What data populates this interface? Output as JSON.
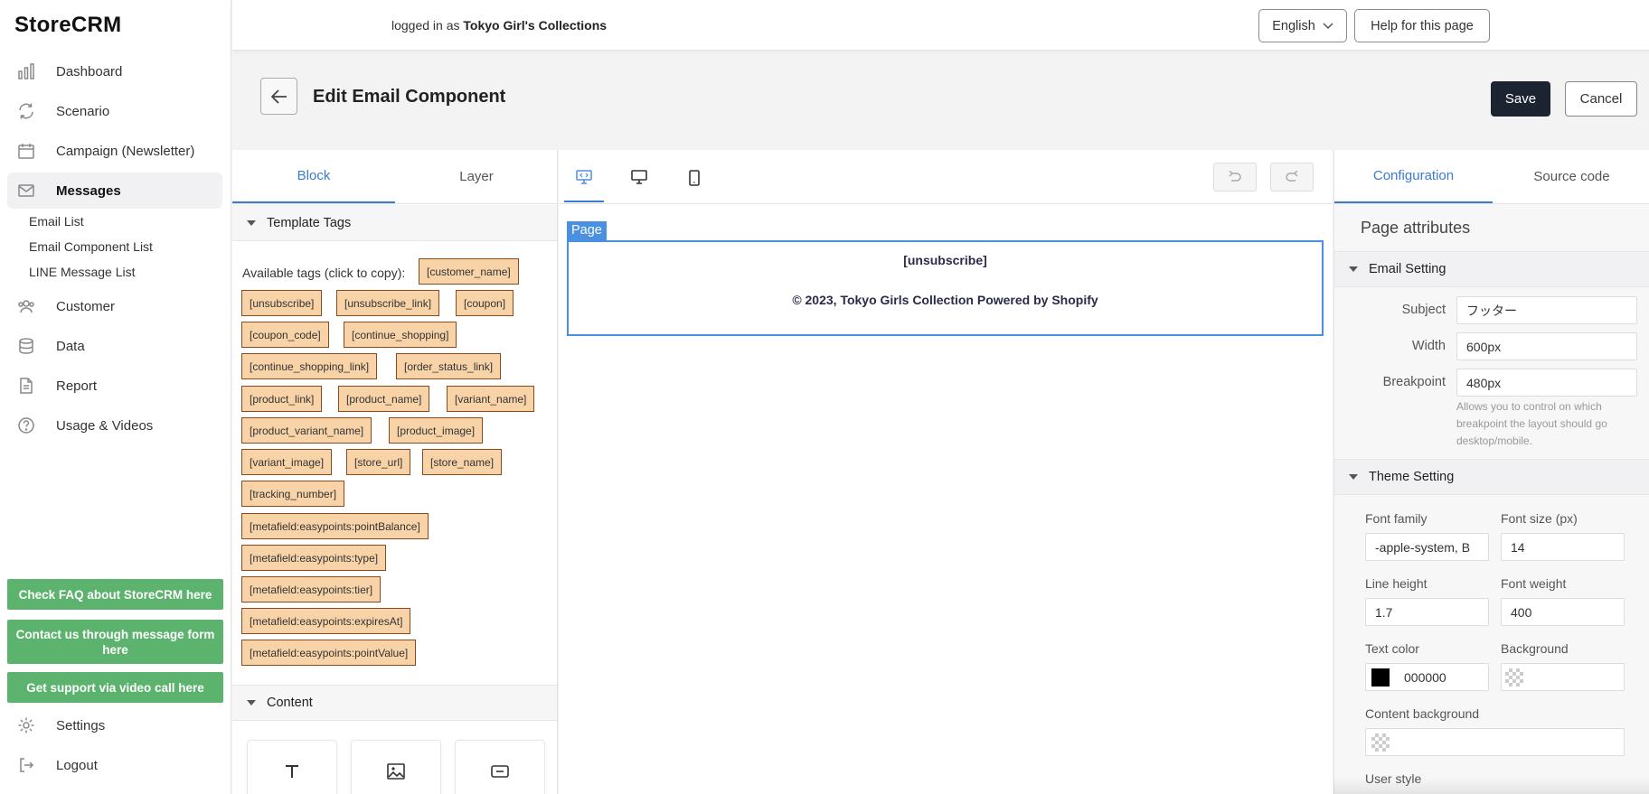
{
  "sidebar": {
    "logo": "StoreCRM",
    "nav": [
      {
        "label": "Dashboard",
        "icon": "chart-bars-icon"
      },
      {
        "label": "Scenario",
        "icon": "refresh-icon"
      },
      {
        "label": "Campaign (Newsletter)",
        "icon": "calendar-icon"
      },
      {
        "label": "Messages",
        "icon": "envelope-icon",
        "active": true
      },
      {
        "label": "Customer",
        "icon": "users-icon"
      },
      {
        "label": "Data",
        "icon": "database-icon"
      },
      {
        "label": "Report",
        "icon": "document-icon"
      },
      {
        "label": "Usage & Videos",
        "icon": "question-icon"
      }
    ],
    "sub_items": [
      "Email List",
      "Email Component List",
      "LINE Message List"
    ],
    "support_buttons": [
      "Check FAQ about StoreCRM here",
      "Contact us through message form here",
      "Get support via video call here"
    ],
    "settings_label": "Settings",
    "logout_label": "Logout"
  },
  "header": {
    "logged_prefix": "logged in as",
    "store_name": "Tokyo Girl's Collections",
    "language": "English",
    "help_label": "Help for this page"
  },
  "page": {
    "title": "Edit Email Component",
    "save_label": "Save",
    "cancel_label": "Cancel"
  },
  "left_panel": {
    "tabs": [
      "Block",
      "Layer"
    ],
    "template_tags_title": "Template Tags",
    "available_label": "Available tags (click to copy):",
    "tags": [
      "[customer_name]",
      "[unsubscribe]",
      "[unsubscribe_link]",
      "[coupon]",
      "[coupon_code]",
      "[continue_shopping]",
      "[continue_shopping_link]",
      "[order_status_link]",
      "[product_link]",
      "[product_name]",
      "[variant_name]",
      "[product_variant_name]",
      "[product_image]",
      "[variant_image]",
      "[store_url]",
      "[store_name]",
      "[tracking_number]",
      "[metafield:easypoints:pointBalance]",
      "[metafield:easypoints:type]",
      "[metafield:easypoints:tier]",
      "[metafield:easypoints:expiresAt]",
      "[metafield:easypoints:pointValue]"
    ],
    "content_title": "Content",
    "content_tiles": [
      "text-icon",
      "image-icon",
      "button-icon"
    ]
  },
  "canvas": {
    "page_badge": "Page",
    "unsubscribe_text": "[unsubscribe]",
    "footer_text": "© 2023, Tokyo Girls Collection Powered by Shopify"
  },
  "right_panel": {
    "tabs": [
      "Configuration",
      "Source code"
    ],
    "page_attributes": "Page attributes",
    "email_setting_title": "Email Setting",
    "subject_label": "Subject",
    "subject_value": "フッター",
    "width_label": "Width",
    "width_value": "600px",
    "breakpoint_label": "Breakpoint",
    "breakpoint_value": "480px",
    "breakpoint_hint": "Allows you to control on which breakpoint the layout should go desktop/mobile.",
    "theme_setting_title": "Theme Setting",
    "font_family_label": "Font family",
    "font_family_value": "-apple-system, B",
    "font_size_label": "Font size (px)",
    "font_size_value": "14",
    "line_height_label": "Line height",
    "line_height_value": "1.7",
    "font_weight_label": "Font weight",
    "font_weight_value": "400",
    "text_color_label": "Text color",
    "text_color_value": "000000",
    "background_label": "Background",
    "background_value": "",
    "content_background_label": "Content background",
    "content_background_value": "",
    "user_style_label": "User style"
  },
  "colors": {
    "accent": "#3a7bd5",
    "green": "#5cb36e",
    "save_bg": "#1c2431",
    "tag_bg": "#f8d3a8",
    "canvas_frame": "#4a90e2",
    "text_color_swatch": "#000000"
  }
}
